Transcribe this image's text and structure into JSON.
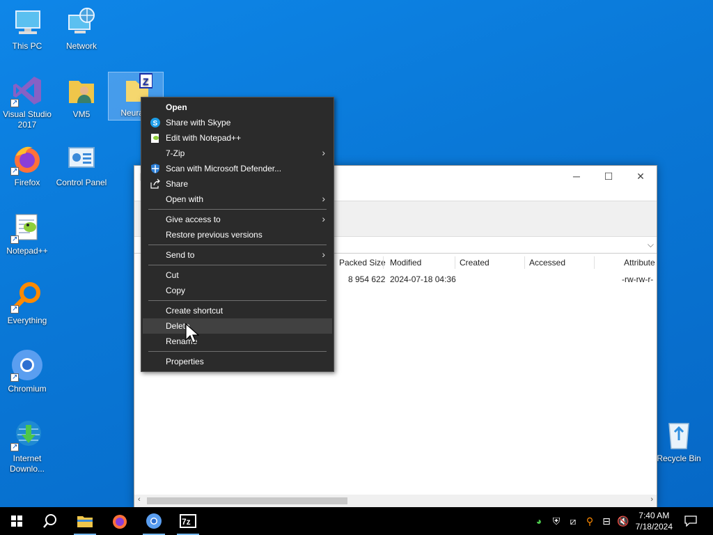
{
  "desktop": {
    "icons": [
      {
        "label": "This PC"
      },
      {
        "label": "Network"
      },
      {
        "label": "Visual Studio 2017"
      },
      {
        "label": "VM5"
      },
      {
        "label": "NeuralA"
      },
      {
        "label": "Firefox"
      },
      {
        "label": "Control Panel"
      },
      {
        "label": "Notepad++"
      },
      {
        "label": "Everything"
      },
      {
        "label": "Chromium"
      },
      {
        "label": "Internet Downlo..."
      },
      {
        "label": "Recycle Bin"
      }
    ]
  },
  "zip_window": {
    "title_initial": "[",
    "columns": [
      "Packed Size",
      "Modified",
      "Created",
      "Accessed",
      "Attribute"
    ],
    "row": {
      "packed_size": "8 954 622",
      "modified": "2024-07-18 04:36",
      "attributes": "-rw-rw-r-"
    }
  },
  "context_menu": {
    "items": [
      {
        "label": "Open"
      },
      {
        "label": "Share with Skype"
      },
      {
        "label": "Edit with Notepad++"
      },
      {
        "label": "7-Zip"
      },
      {
        "label": "Scan with Microsoft Defender..."
      },
      {
        "label": "Share"
      },
      {
        "label": "Open with"
      },
      {
        "label": "Give access to"
      },
      {
        "label": "Restore previous versions"
      },
      {
        "label": "Send to"
      },
      {
        "label": "Cut"
      },
      {
        "label": "Copy"
      },
      {
        "label": "Create shortcut"
      },
      {
        "label": "Delete"
      },
      {
        "label": "Rename"
      },
      {
        "label": "Properties"
      }
    ],
    "hovered": "Delete"
  },
  "taskbar": {
    "apps": [
      "Start",
      "Search",
      "File Explorer",
      "Firefox",
      "Chromium",
      "7-Zip"
    ],
    "time": "7:40 AM",
    "date": "7/18/2024"
  },
  "colors": {
    "desktop": "#0a78d7",
    "menu_bg": "#2b2b2b",
    "menu_hover": "#414141",
    "taskbar": "#000000"
  }
}
